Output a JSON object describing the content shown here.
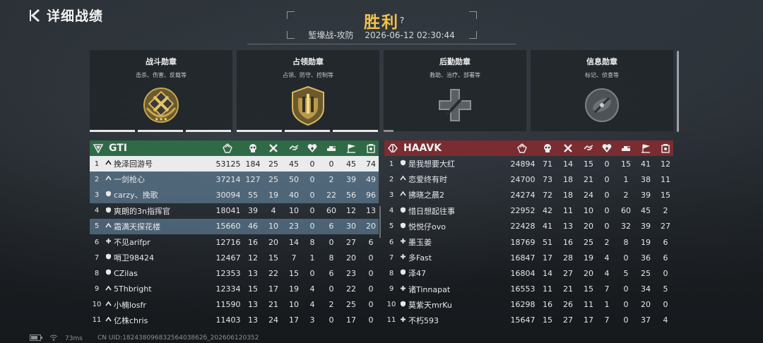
{
  "header": {
    "back_label": "详细战绩",
    "result": "胜利",
    "help": "?",
    "mode": "堑壕战-攻防",
    "datetime": "2026-06-12 02:30:44"
  },
  "medals": [
    {
      "title": "战斗勋章",
      "subtitle": "击杀、伤害、反载等",
      "icon": "combat-medal-icon"
    },
    {
      "title": "占领勋章",
      "subtitle": "占领、防守、控制等",
      "icon": "capture-medal-icon"
    },
    {
      "title": "后勤勋章",
      "subtitle": "救助、治疗、部署等",
      "icon": "logistics-medal-icon"
    },
    {
      "title": "信息勋章",
      "subtitle": "标记、侦查等",
      "icon": "intel-medal-icon"
    }
  ],
  "columns_icons": [
    "score-icon",
    "kills-icon",
    "deaths-icon",
    "assists-icon",
    "revives-icon",
    "vehicle-icon",
    "capture-icon",
    "supply-icon"
  ],
  "team_left": {
    "name": "GTI",
    "color": "#2f6a46",
    "rows": [
      {
        "rank": "1",
        "prefix": "^",
        "name": "挽泽回游号",
        "v": [
          "53125",
          "184",
          "25",
          "45",
          "0",
          "0",
          "45",
          "74"
        ],
        "style": "me"
      },
      {
        "rank": "2",
        "prefix": "^",
        "name": "一剑枪心",
        "v": [
          "37214",
          "127",
          "25",
          "50",
          "0",
          "2",
          "39",
          "49"
        ],
        "style": "hl"
      },
      {
        "rank": "3",
        "prefix": "shield",
        "name": "carzy、挽歌",
        "v": [
          "30094",
          "55",
          "19",
          "40",
          "0",
          "22",
          "56",
          "96"
        ],
        "style": "hl"
      },
      {
        "rank": "4",
        "prefix": "shield",
        "name": "爽朗的3n指挥官",
        "v": [
          "18041",
          "39",
          "4",
          "10",
          "0",
          "60",
          "12",
          "13"
        ],
        "style": ""
      },
      {
        "rank": "5",
        "prefix": "^",
        "name": "霜满天探花楼",
        "v": [
          "15660",
          "46",
          "10",
          "23",
          "0",
          "6",
          "30",
          "20"
        ],
        "style": "hl"
      },
      {
        "rank": "6",
        "prefix": "+",
        "name": "不见arifpr",
        "v": [
          "12716",
          "16",
          "20",
          "14",
          "8",
          "0",
          "27",
          "6"
        ],
        "style": ""
      },
      {
        "rank": "7",
        "prefix": "shield",
        "name": "哨卫98424",
        "v": [
          "12467",
          "12",
          "15",
          "7",
          "1",
          "8",
          "20",
          "0"
        ],
        "style": ""
      },
      {
        "rank": "8",
        "prefix": "shield",
        "name": "CZilas",
        "v": [
          "12353",
          "13",
          "22",
          "15",
          "0",
          "6",
          "23",
          "0"
        ],
        "style": ""
      },
      {
        "rank": "9",
        "prefix": "^",
        "name": "5Thbright",
        "v": [
          "12334",
          "15",
          "17",
          "19",
          "4",
          "0",
          "22",
          "0"
        ],
        "style": ""
      },
      {
        "rank": "10",
        "prefix": "^",
        "name": "小楠losfr",
        "v": [
          "11590",
          "13",
          "21",
          "10",
          "4",
          "2",
          "25",
          "0"
        ],
        "style": ""
      },
      {
        "rank": "11",
        "prefix": "^",
        "name": "亿株chris",
        "v": [
          "11403",
          "13",
          "24",
          "17",
          "3",
          "0",
          "17",
          "0"
        ],
        "style": ""
      }
    ]
  },
  "team_right": {
    "name": "HAAVK",
    "color": "#7a2c30",
    "rows": [
      {
        "rank": "1",
        "prefix": "shield",
        "name": "是我想要大红",
        "v": [
          "24894",
          "71",
          "14",
          "15",
          "0",
          "15",
          "41",
          "12"
        ],
        "style": ""
      },
      {
        "rank": "2",
        "prefix": "^",
        "name": "恋爱终有时",
        "v": [
          "24700",
          "73",
          "18",
          "21",
          "0",
          "1",
          "38",
          "11"
        ],
        "style": ""
      },
      {
        "rank": "3",
        "prefix": "^",
        "name": "拂晓之晨2",
        "v": [
          "24274",
          "72",
          "18",
          "24",
          "0",
          "2",
          "39",
          "15"
        ],
        "style": ""
      },
      {
        "rank": "4",
        "prefix": "shield",
        "name": "惜日想起往事",
        "v": [
          "22952",
          "42",
          "11",
          "10",
          "0",
          "60",
          "45",
          "2"
        ],
        "style": ""
      },
      {
        "rank": "5",
        "prefix": "shield",
        "name": "悦悦仔ovo",
        "v": [
          "22428",
          "41",
          "13",
          "20",
          "0",
          "32",
          "39",
          "27"
        ],
        "style": ""
      },
      {
        "rank": "6",
        "prefix": "+",
        "name": "墨玉姜",
        "v": [
          "18769",
          "51",
          "16",
          "25",
          "2",
          "8",
          "19",
          "6"
        ],
        "style": ""
      },
      {
        "rank": "7",
        "prefix": "+",
        "name": "多Fast",
        "v": [
          "16847",
          "17",
          "28",
          "19",
          "4",
          "0",
          "36",
          "6"
        ],
        "style": ""
      },
      {
        "rank": "8",
        "prefix": "shield",
        "name": "泽47",
        "v": [
          "16804",
          "14",
          "27",
          "20",
          "4",
          "5",
          "25",
          "0"
        ],
        "style": ""
      },
      {
        "rank": "9",
        "prefix": "+",
        "name": "诸Tinnapat",
        "v": [
          "16553",
          "11",
          "21",
          "15",
          "7",
          "0",
          "34",
          "5"
        ],
        "style": ""
      },
      {
        "rank": "10",
        "prefix": "shield",
        "name": "莫紫天mrKu",
        "v": [
          "16298",
          "16",
          "26",
          "11",
          "1",
          "0",
          "20",
          "0"
        ],
        "style": ""
      },
      {
        "rank": "11",
        "prefix": "+",
        "name": "不朽593",
        "v": [
          "15647",
          "15",
          "27",
          "17",
          "7",
          "0",
          "37",
          "4"
        ],
        "style": ""
      }
    ]
  },
  "status": {
    "ping": "73ms",
    "uid": "CN UID:18243809683256403862б_202606120352"
  }
}
